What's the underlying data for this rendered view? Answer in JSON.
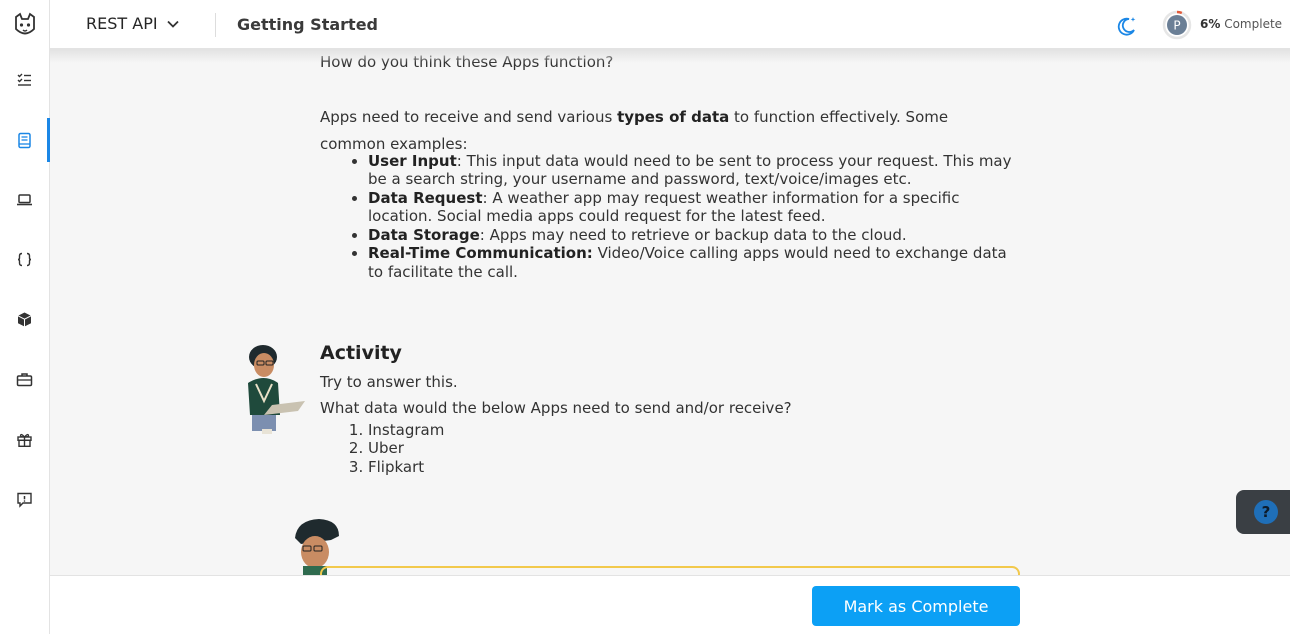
{
  "header": {
    "course": "REST API",
    "section": "Getting Started",
    "progress": {
      "percent_label": "6%",
      "suffix": "Complete",
      "avatar_letter": "P",
      "fraction": 0.06
    }
  },
  "content": {
    "cut_line": "How do you think these Apps function?",
    "intro": {
      "before": "Apps need to receive and send various ",
      "bold": "types of data",
      "after": " to function effectively. Some common examples:"
    },
    "bullets": [
      {
        "title": "User Input",
        "sep": ":",
        "text": " This input data would need to be sent to process your request. This may be a search string, your username and password, text/voice/images etc."
      },
      {
        "title": "Data Request",
        "sep": ":",
        "text": " A weather app may request weather information for a specific location. Social media apps could request for the latest feed."
      },
      {
        "title": "Data Storage",
        "sep": ":",
        "text": " Apps may need to retrieve or backup data to the cloud."
      },
      {
        "title": "Real-Time Communication:",
        "sep": "",
        "text": " Video/Voice calling apps would need to exchange data to facilitate the call."
      }
    ],
    "activity": {
      "title": "Activity",
      "line1": "Try to answer this.",
      "line2": "What data would the below Apps need to send and/or receive?",
      "apps": [
        "Instagram",
        "Uber",
        "Flipkart"
      ]
    }
  },
  "footer": {
    "mark_complete": "Mark as Complete"
  },
  "help": {
    "symbol": "?"
  },
  "colors": {
    "accent": "#0ca0f5",
    "active_nav": "#1b87e6",
    "callout_border": "#f2c94c"
  },
  "sidebar": {
    "icons": [
      "checklist-icon",
      "book-icon",
      "laptop-icon",
      "braces-icon",
      "cube-icon",
      "briefcase-icon",
      "gift-icon",
      "feedback-icon"
    ],
    "active": "book-icon"
  }
}
